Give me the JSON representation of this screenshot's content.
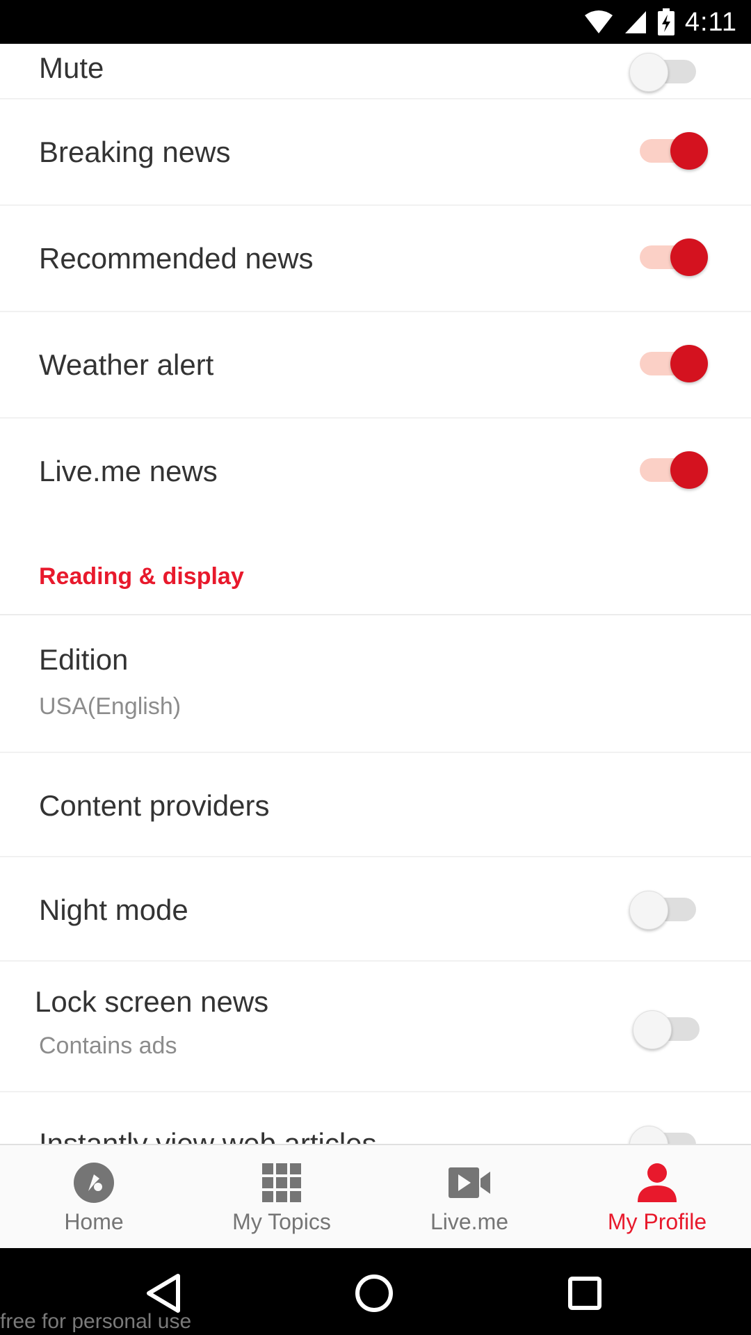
{
  "status_bar": {
    "time": "4:11"
  },
  "notifications": {
    "mute_label": "Mute",
    "mute_on": false,
    "items": [
      {
        "label": "Breaking news",
        "on": true
      },
      {
        "label": "Recommended news",
        "on": true
      },
      {
        "label": "Weather alert",
        "on": true
      },
      {
        "label": "Live.me news",
        "on": true
      }
    ]
  },
  "reading_display": {
    "header": "Reading & display",
    "edition": {
      "label": "Edition",
      "value": "USA(English)"
    },
    "content_providers": {
      "label": "Content providers"
    },
    "night_mode": {
      "label": "Night mode",
      "on": false
    },
    "lock_screen": {
      "label": "Lock screen news",
      "subtitle": "Contains ads",
      "on": false
    },
    "instant_view": {
      "label": "Instantly view web articles",
      "on": false
    }
  },
  "bottom_nav": {
    "items": [
      {
        "label": "Home",
        "icon": "home-compass-icon"
      },
      {
        "label": "My Topics",
        "icon": "grid-icon"
      },
      {
        "label": "Live.me",
        "icon": "video-camera-icon"
      },
      {
        "label": "My Profile",
        "icon": "person-icon"
      }
    ],
    "active_index": 3,
    "active_color": "#e8192c"
  },
  "system_nav": {
    "watermark": "free for personal use"
  },
  "colors": {
    "accent": "#e8192c",
    "toggle_on": "#d4121f",
    "toggle_track_on": "#fbd0c6"
  }
}
